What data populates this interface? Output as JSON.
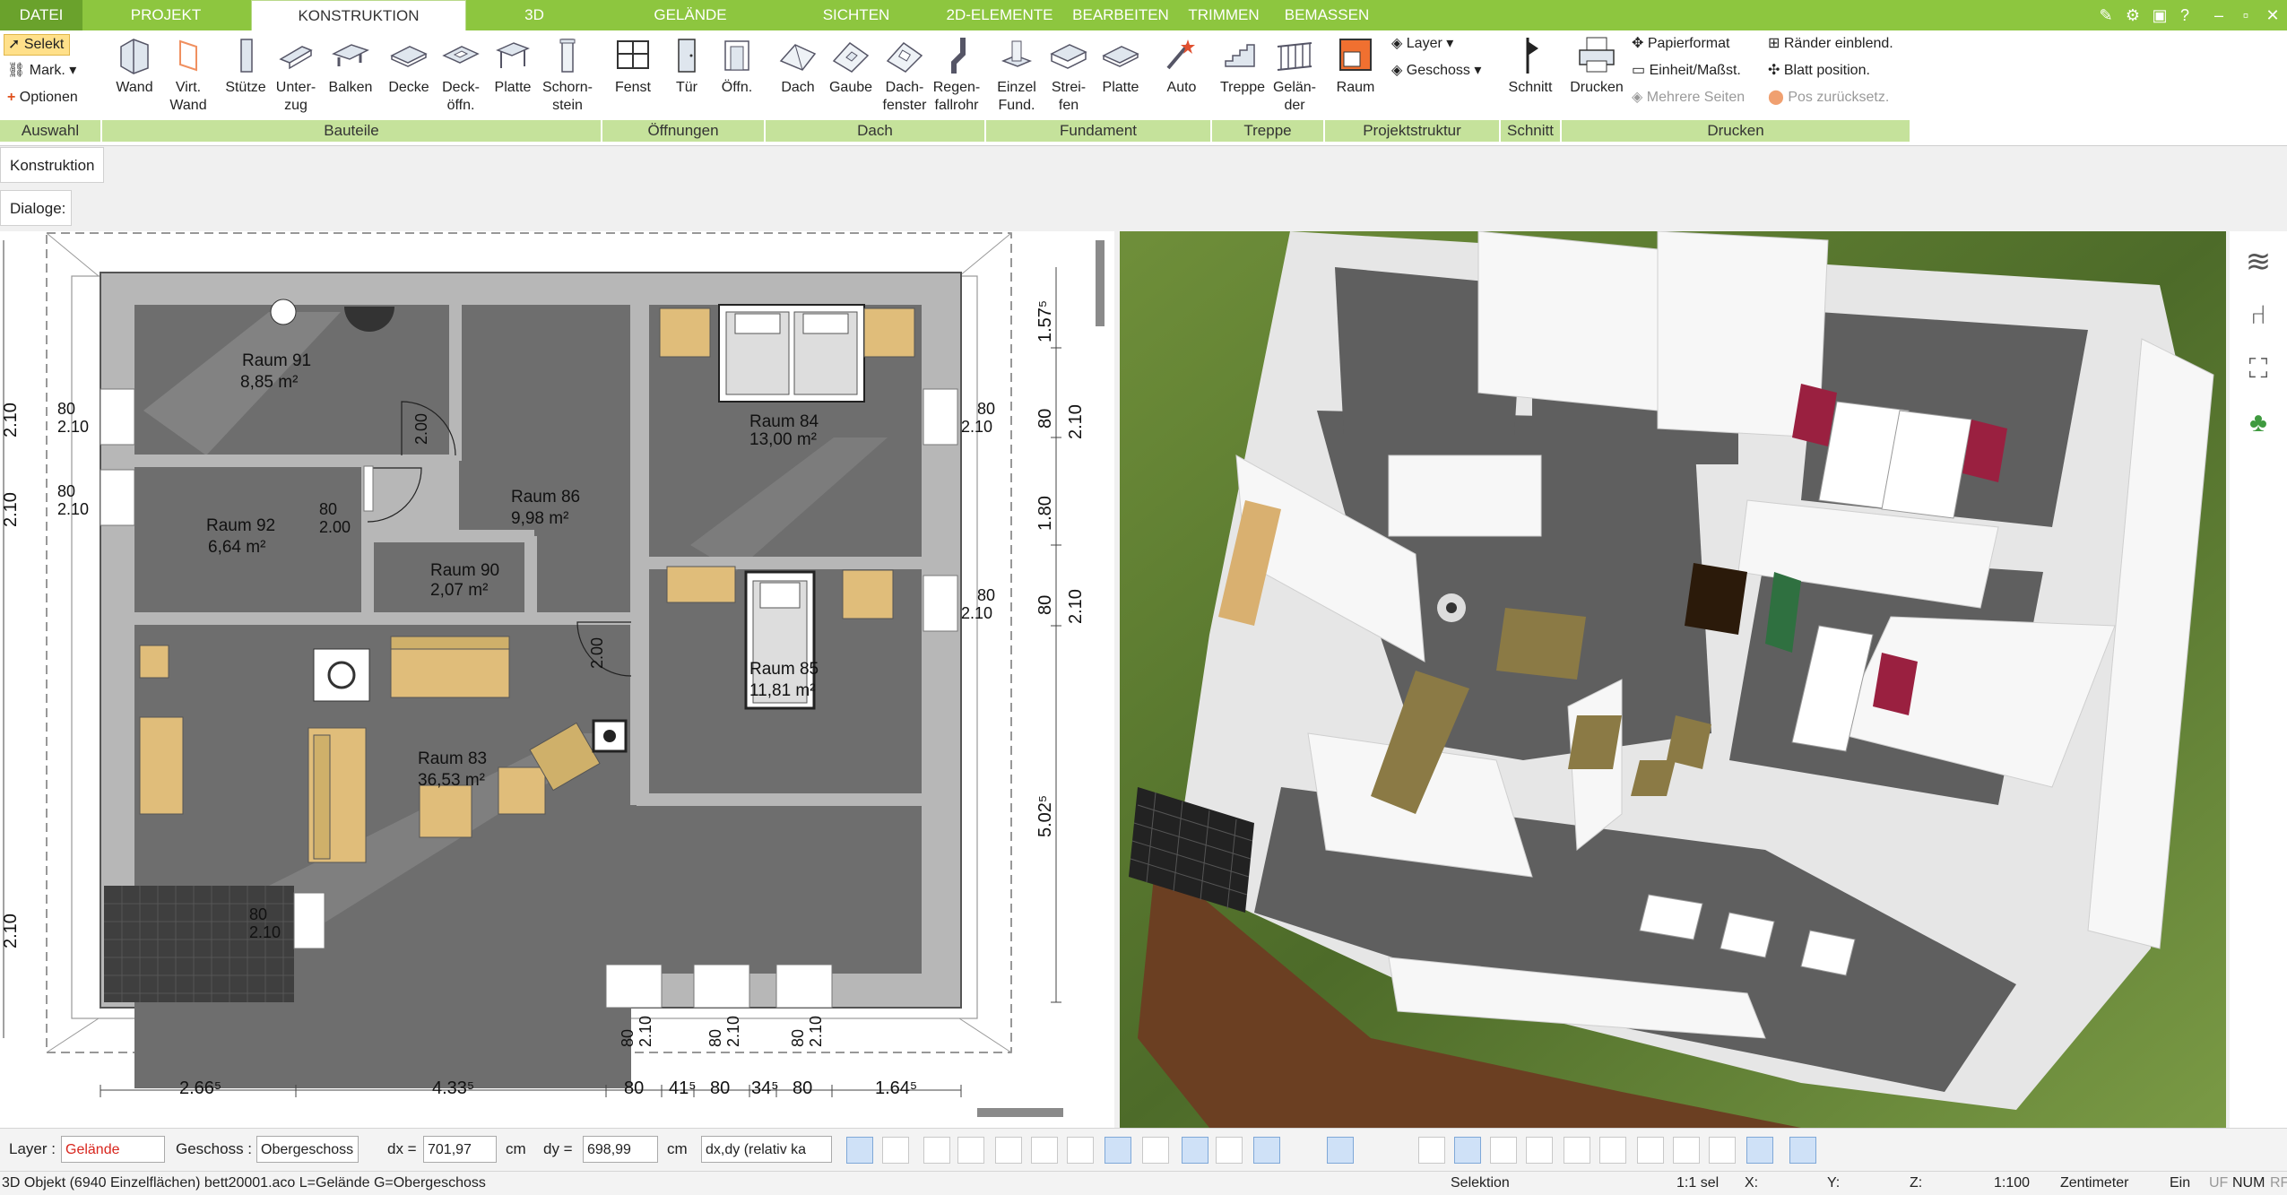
{
  "tabs": [
    {
      "label": "DATEI"
    },
    {
      "label": "PROJEKT"
    },
    {
      "label": "KONSTRUKTION"
    },
    {
      "label": "3D"
    },
    {
      "label": "GELÄNDE"
    },
    {
      "label": "SICHTEN"
    },
    {
      "label": "2D-ELEMENTE"
    },
    {
      "label": "BEARBEITEN"
    },
    {
      "label": "TRIMMEN"
    },
    {
      "label": "BEMASSEN"
    }
  ],
  "active_tab": "KONSTRUKTION",
  "ribbon": {
    "auswahl": {
      "group": "Auswahl",
      "selekt": "Selekt",
      "mark": "Mark.",
      "optionen": "Optionen"
    },
    "bauteile": {
      "group": "Bauteile",
      "wand": "Wand",
      "virt": "Virt.",
      "virt2": "Wand",
      "stuetze": "Stütze",
      "unterzug": "Unter-",
      "unterzug2": "zug",
      "balken": "Balken",
      "decke": "Decke",
      "deckoeffn": "Deck-",
      "deckoeffn2": "öffn.",
      "platte": "Platte",
      "schorn": "Schorn-",
      "schorn2": "stein"
    },
    "oeffnungen": {
      "group": "Öffnungen",
      "fenst": "Fenst",
      "tuer": "Tür",
      "oeffn": "Öffn."
    },
    "dach": {
      "group": "Dach",
      "dach": "Dach",
      "gaube": "Gaube",
      "dachfenster": "Dach-",
      "dachfenster2": "fenster",
      "regenfallrohr": "Regen-",
      "regenfallrohr2": "fallrohr"
    },
    "fundament": {
      "group": "Fundament",
      "einzel": "Einzel",
      "einzel2": "Fund.",
      "streifen": "Strei-",
      "streifen2": "fen",
      "platte": "Platte",
      "auto": "Auto"
    },
    "treppe": {
      "group": "Treppe",
      "treppe": "Treppe",
      "gelaender": "Gelän-",
      "gelaender2": "der"
    },
    "projektstruktur": {
      "group": "Projektstruktur",
      "raum": "Raum",
      "layer": "Layer",
      "geschoss": "Geschoss"
    },
    "schnitt": {
      "group": "Schnitt",
      "schnitt": "Schnitt"
    },
    "drucken": {
      "group": "Drucken",
      "drucken": "Drucken",
      "papierformat": "Papierformat",
      "einheit": "Einheit/Maßst.",
      "mehrere": "Mehrere Seiten",
      "raender": "Ränder einblend.",
      "blatt": "Blatt position.",
      "pos": "Pos zurücksetz."
    }
  },
  "panel_tab": "Konstruktion",
  "dialoge_label": "Dialoge:",
  "rooms": [
    {
      "name": "Raum 91",
      "area": "8,85 m²"
    },
    {
      "name": "Raum 86",
      "area": "9,98 m²"
    },
    {
      "name": "Raum 84",
      "area": "13,00 m²"
    },
    {
      "name": "Raum 92",
      "area": "6,64 m²"
    },
    {
      "name": "Raum 90",
      "area": "2,07 m²"
    },
    {
      "name": "Raum 85",
      "area": "11,81 m²"
    },
    {
      "name": "Raum 83",
      "area": "36,53 m²"
    }
  ],
  "dims": {
    "bottom": [
      "2.66⁵",
      "4.33⁵",
      "80",
      "41⁵",
      "80",
      "34⁵",
      "80",
      "1.64⁵"
    ],
    "right": [
      "1.57⁵",
      "2.10",
      "80",
      "1.80",
      "2.10",
      "80",
      "5.02⁵"
    ],
    "left": [
      "2.10",
      "2.10",
      "2.10"
    ],
    "openings": [
      "80",
      "2.10",
      "2.00",
      "80",
      "2.00"
    ]
  },
  "status": {
    "layer_label": "Layer :",
    "layer_value": "Gelände",
    "geschoss_label": "Geschoss :",
    "geschoss_value": "Obergeschoss",
    "dx_label": "dx =",
    "dx_value": "701,97",
    "dy_label": "dy =",
    "dy_value": "698,99",
    "unit": "cm",
    "mode": "dx,dy (relativ ka"
  },
  "info": {
    "object": "3D Objekt (6940 Einzelflächen) bett20001.aco L=Gelände G=Obergeschoss",
    "selektion": "Selektion",
    "sel": "1:1 sel",
    "x": "X:",
    "y": "Y:",
    "z": "Z:",
    "scale": "1:100",
    "unit": "Zentimeter",
    "ein": "Ein",
    "uf": "UF",
    "num": "NUM",
    "rf": "RF"
  },
  "colors": {
    "ribbon_green": "#8dc63f",
    "group_green": "#c5e29b",
    "layer_red": "#d8251d"
  }
}
